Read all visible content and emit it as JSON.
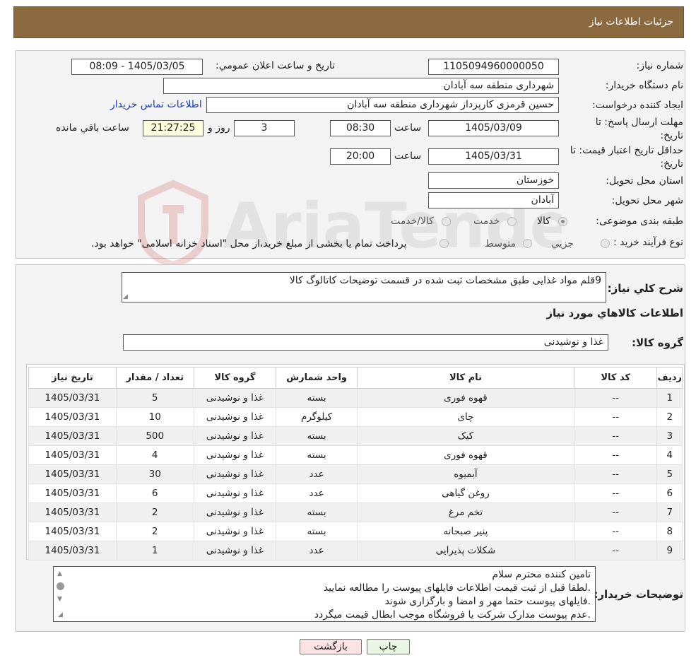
{
  "header": {
    "title": "جزئيات اطلاعات نياز"
  },
  "info": {
    "need_no_label": "شماره نياز:",
    "need_no": "1105094960000050",
    "announce_label": "تاريخ و ساعت اعلان عمومي:",
    "announce_value": "1405/03/05 - 08:09",
    "buyer_label": "نام دستگاه خريدار:",
    "buyer_value": "شهرداری منطقه سه آبادان",
    "creator_label": "ايجاد کننده درخواست:",
    "creator_value": "حسین قرمزی کارپرداز شهرداری منطقه سه آبادان",
    "contact_link": "اطلاعات تماس خريدار",
    "deadline_label_1": "مهلت ارسال پاسخ: تا",
    "deadline_label_2": "تاريخ:",
    "deadline_date": "1405/03/09",
    "time_label": "ساعت",
    "deadline_time": "08:30",
    "days_value": "3",
    "days_label": "روز و",
    "remaining_time": "21:27:25",
    "remaining_label": "ساعت باقي مانده",
    "validity_label_1": "حداقل تاريخ اعتبار قيمت: تا",
    "validity_label_2": "تاريخ:",
    "validity_date": "1405/03/31",
    "validity_time": "20:00",
    "province_label": "استان محل تحويل:",
    "province_value": "خوزستان",
    "city_label": "شهر محل تحويل:",
    "city_value": "آبادان",
    "category_label": "طبقه بندی موضوعی:",
    "category_options": [
      "کالا",
      "خدمت",
      "کالا/خدمت"
    ],
    "category_selected": 0,
    "process_label": "نوع فرآيند خريد :",
    "process_options": [
      "جزيي",
      "متوسط"
    ],
    "process_note": "پرداخت تمام یا بخشی از مبلغ خرید،از محل \"اسناد خزانه اسلامی\" خواهد بود."
  },
  "summary": {
    "desc_label": "شرح کلي نياز:",
    "desc_value": "9قلم مواد غذایی طبق مشخصات ثبت شده در قسمت توضیحات کاتالوگ کالا",
    "goods_title": "اطلاعات کالاهاي مورد نياز",
    "group_label": "گروه کالا:",
    "group_value": "غذا و نوشیدنی"
  },
  "table": {
    "headers": [
      "رديف",
      "کد کالا",
      "نام کالا",
      "واحد شمارش",
      "گروه کالا",
      "تعداد / مقدار",
      "تاريخ نياز"
    ],
    "rows": [
      [
        "1",
        "--",
        "قهوه فوری",
        "بسته",
        "غذا و نوشیدنی",
        "5",
        "1405/03/31"
      ],
      [
        "2",
        "--",
        "چای",
        "کیلوگرم",
        "غذا و نوشیدنی",
        "10",
        "1405/03/31"
      ],
      [
        "3",
        "--",
        "کیک",
        "بسته",
        "غذا و نوشیدنی",
        "500",
        "1405/03/31"
      ],
      [
        "4",
        "--",
        "قهوه فوری",
        "بسته",
        "غذا و نوشیدنی",
        "4",
        "1405/03/31"
      ],
      [
        "5",
        "--",
        "آبمیوه",
        "عدد",
        "غذا و نوشیدنی",
        "30",
        "1405/03/31"
      ],
      [
        "6",
        "--",
        "روغن گیاهی",
        "عدد",
        "غذا و نوشیدنی",
        "6",
        "1405/03/31"
      ],
      [
        "7",
        "--",
        "تخم مرغ",
        "بسته",
        "غذا و نوشیدنی",
        "2",
        "1405/03/31"
      ],
      [
        "8",
        "--",
        "پنیر صبحانه",
        "بسته",
        "غذا و نوشیدنی",
        "2",
        "1405/03/31"
      ],
      [
        "9",
        "--",
        "شکلات پذیرایی",
        "عدد",
        "غذا و نوشیدنی",
        "1",
        "1405/03/31"
      ]
    ]
  },
  "notes": {
    "label": "توضيحات خريدار:",
    "lines": [
      "تامین کننده محترم سلام",
      ".لطفا قبل از ثبت قیمت اطلاعات فایلهای پیوست را مطالعه نمایید",
      ".فایلهای پیوست حتما مهر و امضا و بارگزاری شوند",
      ".عدم پیوست مدارک شرکت یا فروشگاه موجب ابطال قیمت میگردد"
    ]
  },
  "buttons": {
    "print": "چاپ",
    "back": "بازگشت"
  },
  "colors": {
    "header": "#8c6a3f",
    "print_btn": "#eaf6e4",
    "back_btn": "#fbe3e3"
  }
}
